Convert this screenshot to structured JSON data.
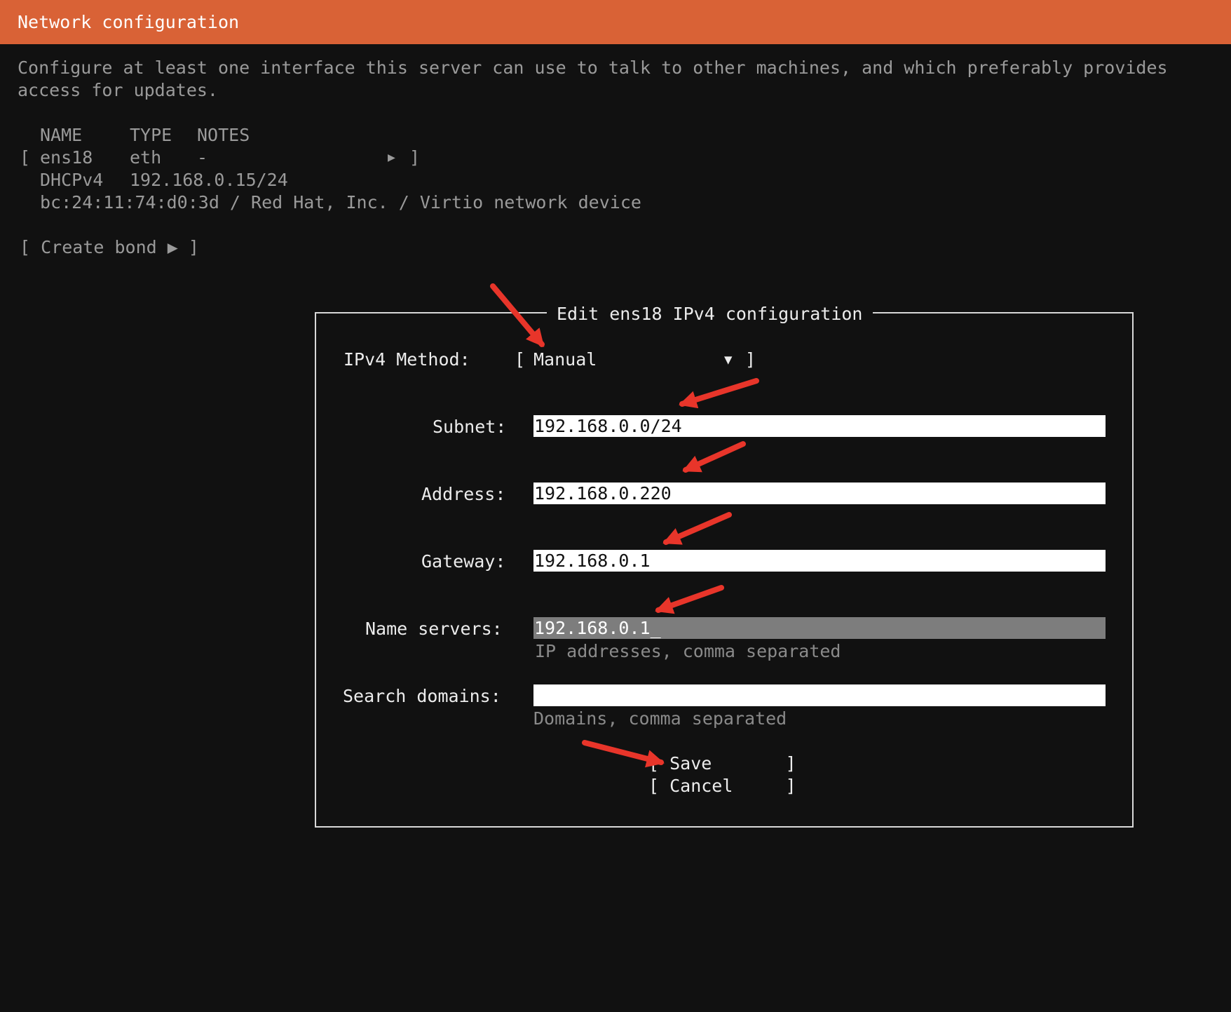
{
  "header": {
    "title": "Network configuration"
  },
  "intro": {
    "line1": "Configure at least one interface this server can use to talk to other machines, and which preferably provides",
    "line2": "access for updates."
  },
  "interfaces": {
    "columns": {
      "name": "NAME",
      "type": "TYPE",
      "notes": "NOTES"
    },
    "items": [
      {
        "open_bracket": "[",
        "name": "ens18",
        "type": "eth",
        "notes": "-",
        "arrow": "▶",
        "close_bracket": "]",
        "dhcp_label": "DHCPv4",
        "dhcp_address": "192.168.0.15/24",
        "device": "bc:24:11:74:d0:3d / Red Hat, Inc. / Virtio network device"
      }
    ]
  },
  "create_bond": {
    "label": "[ Create bond ▶ ]"
  },
  "dialog": {
    "title": "Edit ens18 IPv4 configuration",
    "method": {
      "label": "IPv4 Method:",
      "open_bracket": "[",
      "value": "Manual",
      "caret": "▼",
      "close_bracket": "]"
    },
    "fields": {
      "subnet": {
        "label": "Subnet:",
        "value": "192.168.0.0/24"
      },
      "address": {
        "label": "Address:",
        "value": "192.168.0.220"
      },
      "gateway": {
        "label": "Gateway:",
        "value": "192.168.0.1"
      },
      "name_servers": {
        "label": "Name servers:",
        "value": "192.168.0.1_",
        "hint": "IP addresses, comma separated"
      },
      "search_domains": {
        "label": "Search domains:",
        "value": "",
        "hint": "Domains, comma separated"
      }
    },
    "buttons": {
      "save": "[ Save       ]",
      "cancel": "[ Cancel     ]"
    }
  },
  "colors": {
    "header_bg": "#d96236",
    "background": "#111111",
    "annotation_arrow": "#e8352a"
  }
}
